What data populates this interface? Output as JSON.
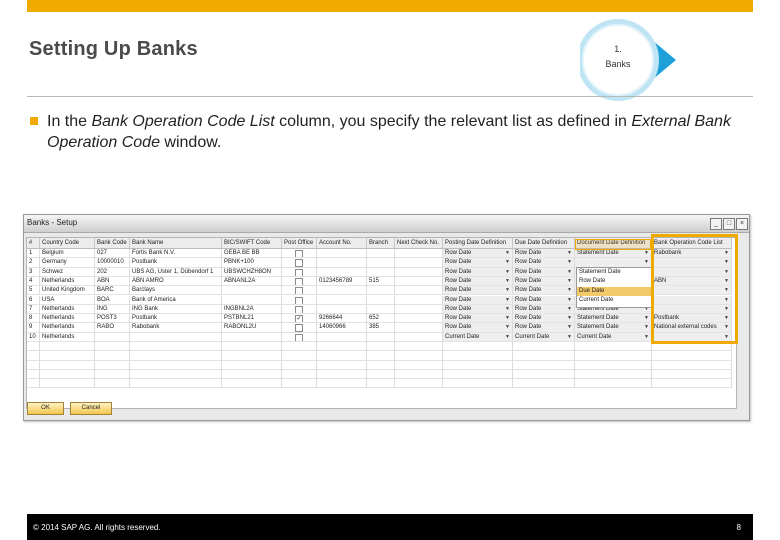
{
  "slide": {
    "title": "Setting Up Banks",
    "step_number": "1.",
    "step_label": "Banks",
    "body_part1": "In the ",
    "body_italic1": "Bank Operation Code List",
    "body_part2": " column, you specify the relevant list as defined in ",
    "body_italic2": "External Bank Operation Code",
    "body_part3": " window.",
    "copyright": "© 2014 SAP AG. All rights reserved.",
    "page_number": "8"
  },
  "window": {
    "title": "Banks - Setup",
    "columns": [
      "#",
      "Country Code",
      "Bank Code",
      "Bank Name",
      "BIC/SWIFT Code",
      "Post Office",
      "Account No.",
      "Branch",
      "Next Check No.",
      "Posting Date Definition",
      "Due Date Definition",
      "Document Date Definition",
      "Bank Operation Code List"
    ],
    "rows": [
      {
        "num": "1",
        "country": "Belgium",
        "code": "027",
        "name": "Fortis Bank N.V.",
        "bic": "GEBA BE BB",
        "account": "",
        "branch": "",
        "posting": "Row Date",
        "due": "Row Date",
        "document": "Statement Date",
        "bocl": "Rabobank"
      },
      {
        "num": "2",
        "country": "Germany",
        "code": "10000010",
        "name": "Postbank",
        "bic": "PBNK+100",
        "account": "",
        "branch": "",
        "posting": "Row Date",
        "due": "Row Date",
        "document": "",
        "bocl": ""
      },
      {
        "num": "3",
        "country": "Schwez",
        "code": "202",
        "name": "UBS AG, Uster 1, Dübendorf 1",
        "bic": "UBSWCHZH8ON",
        "account": "",
        "branch": "",
        "posting": "Row Date",
        "due": "Row Date",
        "document": "",
        "bocl": ""
      },
      {
        "num": "4",
        "country": "Netherlands",
        "code": "ABN",
        "name": "ABN AMRO",
        "bic": "ABNANL2A",
        "account": "0123456789",
        "branch": "515",
        "posting": "Row Date",
        "due": "Row Date",
        "document": "",
        "bocl": "ABN"
      },
      {
        "num": "5",
        "country": "United Kingdom",
        "code": "BARC",
        "name": "Barclays",
        "bic": "",
        "account": "",
        "branch": "",
        "posting": "Row Date",
        "due": "Row Date",
        "document": "",
        "bocl": ""
      },
      {
        "num": "6",
        "country": "USA",
        "code": "BOA",
        "name": "Bank of America",
        "bic": "",
        "account": "",
        "branch": "",
        "posting": "Row Date",
        "due": "Row Date",
        "document": "Statement Date",
        "bocl": ""
      },
      {
        "num": "7",
        "country": "Netherlands",
        "code": "ING",
        "name": "ING Bank",
        "bic": "INGBNL2A",
        "account": "",
        "branch": "",
        "posting": "Row Date",
        "due": "Row Date",
        "document": "Statement Date",
        "bocl": ""
      },
      {
        "num": "8",
        "country": "Netherlands",
        "code": "POST3",
        "name": "Postbank",
        "bic": "PSTBNL21",
        "account": "9266644",
        "branch": "652",
        "posting": "Row Date",
        "due": "Row Date",
        "document": "Statement Date",
        "bocl": "Postbank"
      },
      {
        "num": "9",
        "country": "Netherlands",
        "code": "RABO",
        "name": "Rabobank",
        "bic": "RABONL2U",
        "account": "14060966",
        "branch": "385",
        "posting": "Row Date",
        "due": "Row Date",
        "document": "Statement Date",
        "bocl": "National external codes"
      },
      {
        "num": "10",
        "country": "Netherlands",
        "code": "",
        "name": "",
        "bic": "",
        "account": "",
        "branch": "",
        "posting": "Current Date",
        "due": "Current Date",
        "document": "Current Date",
        "bocl": ""
      }
    ],
    "dropdown_options": [
      "Statement Date",
      "Row Date",
      "Due Date",
      "Current Date"
    ],
    "ok_label": "OK",
    "cancel_label": "Cancel"
  },
  "colors": {
    "accent": "#f0ab00",
    "footer": "#000000"
  }
}
